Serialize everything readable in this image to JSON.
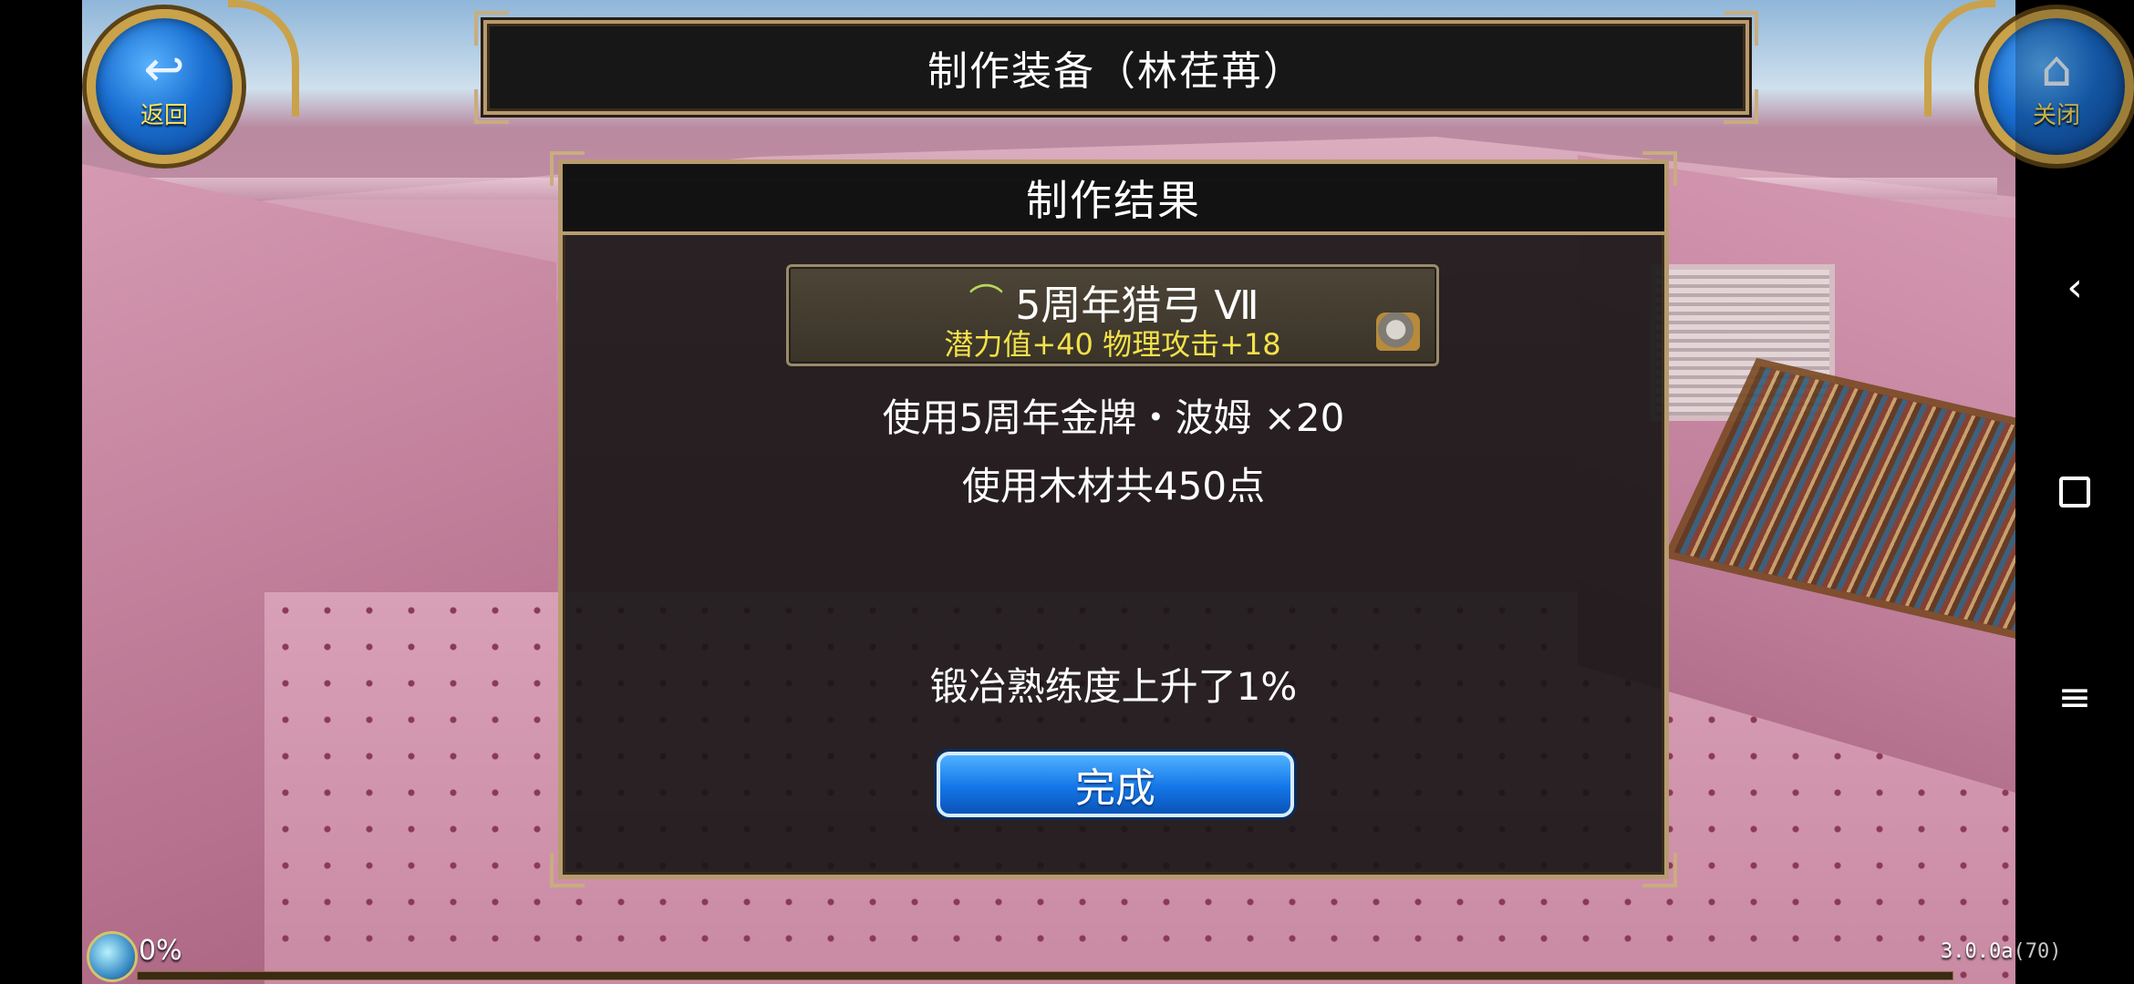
{
  "header": {
    "title": "制作装备（林荏苒）",
    "back_label": "返回",
    "close_label": "关闭",
    "back_icon": "back-arrow-icon",
    "close_icon": "home-icon"
  },
  "dialog": {
    "title": "制作结果",
    "item": {
      "icon": "bow-icon",
      "name": "5周年猎弓 Ⅶ",
      "stats": "潜力值+40  物理攻击+18",
      "badge_icon": "anvil-icon"
    },
    "used_material_1": "使用5周年金牌・波姆 ×20",
    "used_material_2": "使用木材共450点",
    "skill_gain": "锻冶熟练度上升了1%",
    "done_label": "完成"
  },
  "status": {
    "percent": "0%",
    "progress": 0,
    "version": "3.0.0a(70)"
  },
  "nav": {
    "back_glyph": "‹",
    "menu_glyph": "≡"
  },
  "colors": {
    "gold_border": "#b89c70",
    "stat_yellow": "#f3e24a",
    "button_blue": "#1376e8"
  }
}
